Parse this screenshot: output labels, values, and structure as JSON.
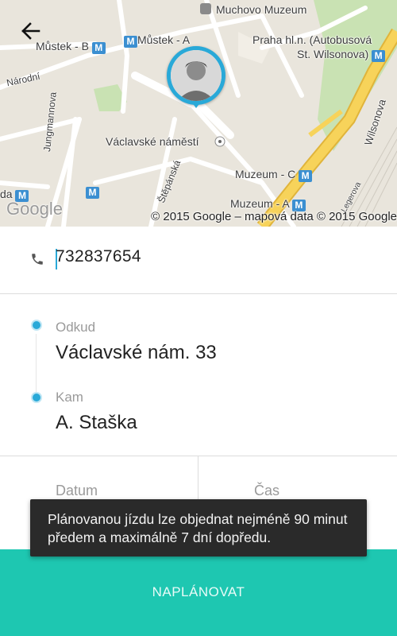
{
  "map": {
    "labels": {
      "muchovo_muzeum": "Muchovo Muzeum",
      "mustek_b": "Můstek - B",
      "mustek_a": "Můstek - A",
      "praha_hln": "Praha hl.n. (Autobusová",
      "st_wilsonova": "St. Wilsonova)",
      "narodni": "Národní",
      "jungmannova": "Jungmannova",
      "vaclavske_namesti": "Václavské náměstí",
      "stepanska": "Štěpánská",
      "muzeum_c": "Muzeum - C",
      "muzeum_a": "Muzeum - A",
      "wilsonova": "Wilsonova",
      "legerova": "Legerova",
      "da": "da"
    },
    "metro_badge": "M",
    "google_logo": "Google",
    "credit": "© 2015 Google – mapová data © 2015 Google"
  },
  "phone": {
    "value": "732837654"
  },
  "route": {
    "from_label": "Odkud",
    "from_value": "Václavské nám. 33",
    "to_label": "Kam",
    "to_value": "A. Staška"
  },
  "datetime": {
    "date_label": "Datum",
    "time_label": "Čas"
  },
  "toast": {
    "message": "Plánovanou jízdu lze objednat nejméně 90 minut předem a maximálně 7 dní dopředu."
  },
  "actions": {
    "schedule_label": "NAPLÁNOVAT"
  },
  "colors": {
    "accent": "#29a9d8",
    "button": "#1ec7b1",
    "toast_bg": "#2a2a2a",
    "road_major": "#f7c84a",
    "metro": "#3b8fd1"
  }
}
